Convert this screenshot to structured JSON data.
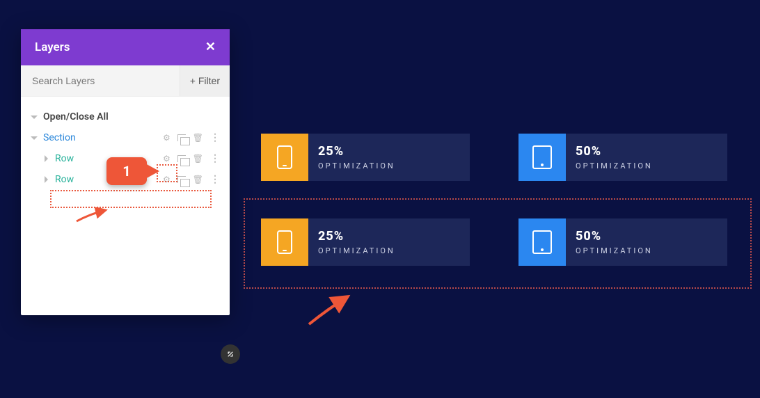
{
  "panel": {
    "title": "Layers",
    "search_placeholder": "Search Layers",
    "filter_label": "Filter",
    "open_close_label": "Open/Close All",
    "section_label": "Section",
    "rows": [
      "Row",
      "Row"
    ]
  },
  "callout": {
    "number": "1"
  },
  "cards": {
    "row1": [
      {
        "pct": "25%",
        "label": "OPTIMIZATION",
        "variant": "orange",
        "device": "phone"
      },
      {
        "pct": "50%",
        "label": "OPTIMIZATION",
        "variant": "blue",
        "device": "tablet"
      }
    ],
    "row2": [
      {
        "pct": "25%",
        "label": "OPTIMIZATION",
        "variant": "orange",
        "device": "phone"
      },
      {
        "pct": "50%",
        "label": "OPTIMIZATION",
        "variant": "blue",
        "device": "tablet"
      }
    ]
  },
  "colors": {
    "accent_purple": "#7e3bd0",
    "accent_orange": "#f5a623",
    "accent_blue": "#2b87f0",
    "callout_red": "#ee5638"
  }
}
